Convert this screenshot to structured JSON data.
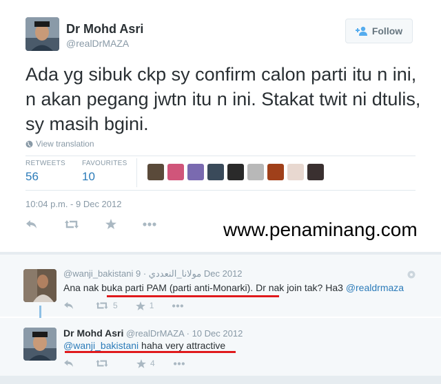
{
  "main_tweet": {
    "author_name": "Dr Mohd Asri",
    "author_handle": "@realDrMAZA",
    "follow_label": "Follow",
    "text": "Ada yg sibuk ckp sy confirm calon parti itu n ini, n akan pegang jwtn itu n ini. Stakat twit ni dtulis, sy masih bgini.",
    "translate_label": "View translation",
    "retweets_label": "RETWEETS",
    "retweets_count": "56",
    "favourites_label": "FAVOURITES",
    "favourites_count": "10",
    "timestamp": "10:04 p.m. - 9 Dec 2012",
    "favourite_avatar_colors": [
      "#5a4a3a",
      "#d0557a",
      "#7a6ab0",
      "#3a4a5a",
      "#2a2a2a",
      "#b8b8b8",
      "#a0401a",
      "#e8d8d0",
      "#3a3030"
    ]
  },
  "watermark": "www.penaminang.com",
  "replies": [
    {
      "handle": "@wanji_bakistani",
      "display_name": "مولانا_النعددي",
      "date": "9 Dec 2012",
      "text_before": "Ana nak buka parti PAM (parti anti-Monarki). Dr nak join tak? Ha3 ",
      "mention": "@realdrmaza",
      "retweets": "5",
      "favourites": "1"
    },
    {
      "author_name": "Dr Mohd Asri",
      "handle": "@realDrMAZA",
      "date": "10 Dec 2012",
      "mention": "@wanji_bakistani",
      "text_after": " haha very attractive",
      "retweets": "",
      "favourites": "4"
    }
  ],
  "colors": {
    "link_blue": "#2b7bb9",
    "muted_gray": "#8899a6",
    "underline_red": "#e0191c"
  }
}
